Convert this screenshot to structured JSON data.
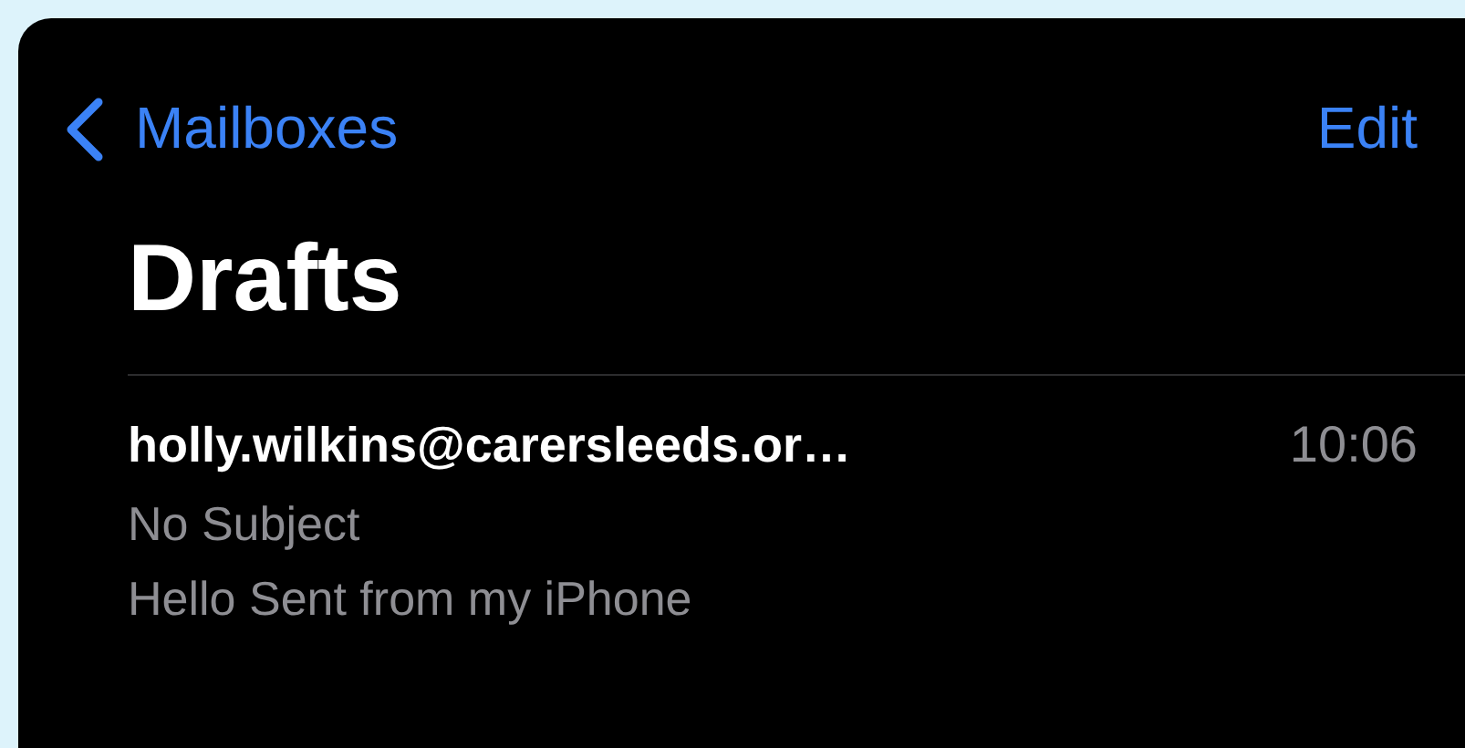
{
  "nav": {
    "back_label": "Mailboxes",
    "action": "Edit"
  },
  "title": "Drafts",
  "messages": [
    {
      "sender": "holly.wilkins@carersleeds.or…",
      "time": "10:06",
      "subject": "No Subject",
      "preview": "Hello Sent from my iPhone"
    }
  ]
}
